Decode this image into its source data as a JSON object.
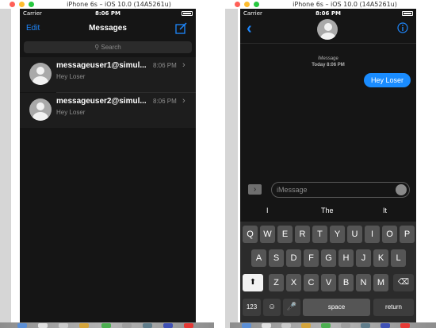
{
  "left_window": {
    "title": "iPhone 6s – iOS 10.0 (14A5261u)",
    "status": {
      "carrier": "Carrier",
      "time": "8:06 PM"
    },
    "nav": {
      "edit": "Edit",
      "title": "Messages",
      "compose_icon": "compose-icon"
    },
    "search_placeholder": "Search",
    "conversations": [
      {
        "name": "messageuser1@simul...",
        "time": "8:06 PM",
        "preview": "Hey Loser"
      },
      {
        "name": "messageuser2@simul...",
        "time": "8:06 PM",
        "preview": "Hey Loser"
      }
    ]
  },
  "right_window": {
    "title": "iPhone 6s – iOS 10.0 (14A5261u)",
    "status": {
      "carrier": "Carrier",
      "time": "8:06 PM"
    },
    "nav": {
      "back_icon": "chevron-left-icon",
      "info_icon": "info-icon"
    },
    "thread": {
      "service": "iMessage",
      "timestamp": "Today 8:06 PM",
      "bubble": "Hey Loser"
    },
    "composer": {
      "placeholder": "iMessage",
      "apps_icon": "chevron-right-icon",
      "mic_icon": "dictation-icon"
    },
    "suggestions": [
      "I",
      "The",
      "It"
    ],
    "keyboard": {
      "row1": [
        "Q",
        "W",
        "E",
        "R",
        "T",
        "Y",
        "U",
        "I",
        "O",
        "P"
      ],
      "row2": [
        "A",
        "S",
        "D",
        "F",
        "G",
        "H",
        "J",
        "K",
        "L"
      ],
      "row3": [
        "Z",
        "X",
        "C",
        "V",
        "B",
        "N",
        "M"
      ],
      "shift_icon": "shift-icon",
      "delete_icon": "delete-icon",
      "numbers": "123",
      "emoji_icon": "emoji-icon",
      "mic_icon": "microphone-icon",
      "space": "space",
      "return": "return"
    }
  },
  "colors": {
    "accent": "#1e88ff",
    "bubble": "#1a8cff",
    "screen_bg": "#151515"
  }
}
